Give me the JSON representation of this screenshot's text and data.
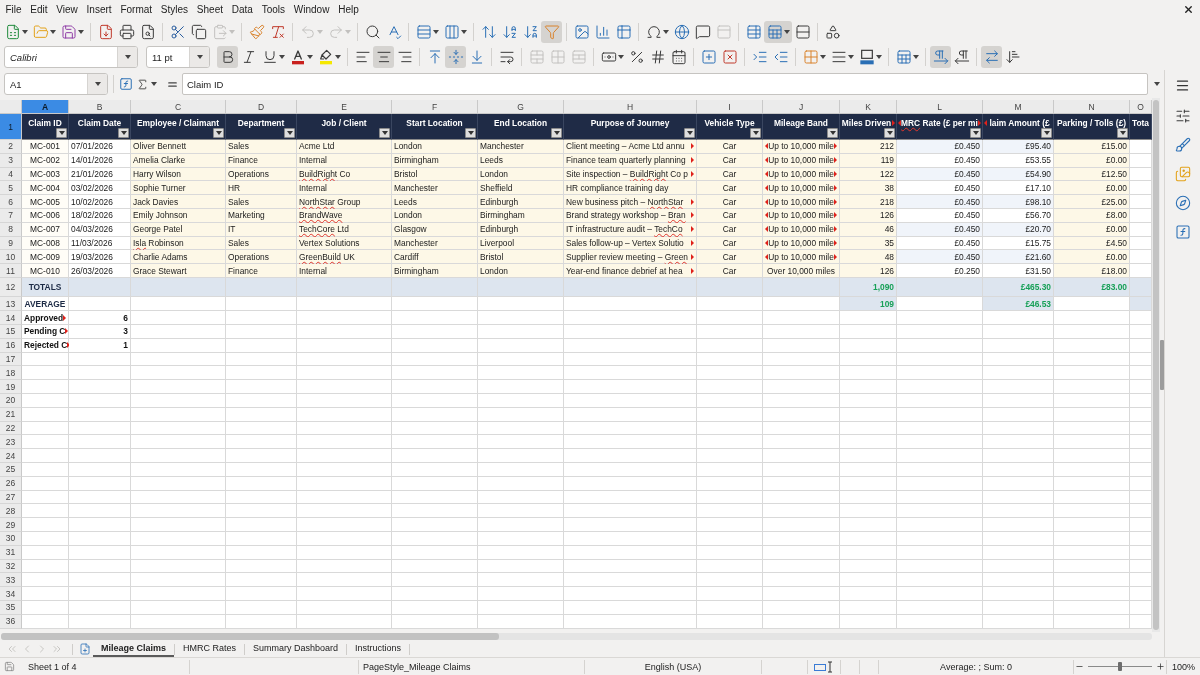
{
  "menu_bar": {
    "items": [
      "File",
      "Edit",
      "View",
      "Insert",
      "Format",
      "Styles",
      "Sheet",
      "Data",
      "Tools",
      "Window",
      "Help"
    ]
  },
  "standard_toolbar": {
    "groups": [
      [
        {
          "kind": "new",
          "menu": true,
          "pressed": false,
          "disabled": false
        },
        {
          "kind": "open",
          "menu": true,
          "pressed": false,
          "disabled": false
        },
        {
          "kind": "save",
          "menu": true,
          "pressed": false,
          "disabled": false
        }
      ],
      [
        {
          "kind": "pdf",
          "menu": false,
          "pressed": false,
          "disabled": false
        },
        {
          "kind": "print",
          "menu": false,
          "pressed": false,
          "disabled": false
        },
        {
          "kind": "preview",
          "menu": false,
          "pressed": false,
          "disabled": false
        }
      ],
      [
        {
          "kind": "cut",
          "menu": false,
          "pressed": false,
          "disabled": false
        },
        {
          "kind": "copy",
          "menu": false,
          "pressed": false,
          "disabled": false
        },
        {
          "kind": "paste",
          "menu": true,
          "pressed": false,
          "disabled": true
        }
      ],
      [
        {
          "kind": "brush",
          "menu": false,
          "pressed": false,
          "disabled": false
        },
        {
          "kind": "clear",
          "menu": false,
          "pressed": false,
          "disabled": false
        }
      ],
      [
        {
          "kind": "undo",
          "menu": true,
          "pressed": false,
          "disabled": true
        },
        {
          "kind": "redo",
          "menu": true,
          "pressed": false,
          "disabled": true
        }
      ],
      [
        {
          "kind": "find",
          "menu": false,
          "pressed": false,
          "disabled": false
        },
        {
          "kind": "spelling",
          "menu": false,
          "pressed": false,
          "disabled": false
        }
      ],
      [
        {
          "kind": "rows",
          "menu": true,
          "pressed": false,
          "disabled": false
        },
        {
          "kind": "columns",
          "menu": true,
          "pressed": false,
          "disabled": false
        }
      ],
      [
        {
          "kind": "sort",
          "menu": false,
          "pressed": false,
          "disabled": false
        },
        {
          "kind": "ascending",
          "menu": false,
          "pressed": false,
          "disabled": false
        },
        {
          "kind": "descending",
          "menu": false,
          "pressed": false,
          "disabled": false
        },
        {
          "kind": "filter",
          "menu": false,
          "pressed": true,
          "disabled": false
        }
      ],
      [
        {
          "kind": "image",
          "menu": false,
          "pressed": false,
          "disabled": false
        },
        {
          "kind": "chart",
          "menu": false,
          "pressed": false,
          "disabled": false
        },
        {
          "kind": "pivot",
          "menu": false,
          "pressed": false,
          "disabled": false
        }
      ],
      [
        {
          "kind": "symbol",
          "menu": true,
          "pressed": false,
          "disabled": false
        },
        {
          "kind": "link",
          "menu": false,
          "pressed": false,
          "disabled": false
        },
        {
          "kind": "comment",
          "menu": false,
          "pressed": false,
          "disabled": false
        },
        {
          "kind": "headers",
          "menu": false,
          "pressed": false,
          "disabled": true
        }
      ],
      [
        {
          "kind": "printarea",
          "menu": false,
          "pressed": false,
          "disabled": false
        },
        {
          "kind": "freeze",
          "menu": true,
          "pressed": true,
          "disabled": false
        },
        {
          "kind": "split",
          "menu": false,
          "pressed": false,
          "disabled": false
        }
      ],
      [
        {
          "kind": "shapes",
          "menu": false,
          "pressed": false,
          "disabled": false
        }
      ]
    ]
  },
  "formatting_toolbar": {
    "font_name": {
      "value": "Calibri"
    },
    "font_size": {
      "value": "11 pt"
    },
    "groups": [
      [
        {
          "kind": "bold",
          "menu": false,
          "pressed": true,
          "disabled": false
        },
        {
          "kind": "italic",
          "menu": false,
          "pressed": false,
          "disabled": false
        },
        {
          "kind": "underline",
          "menu": true,
          "pressed": false,
          "disabled": false
        },
        {
          "kind": "fontcolor",
          "menu": true,
          "pressed": false,
          "disabled": false
        },
        {
          "kind": "highlight",
          "menu": true,
          "pressed": false,
          "disabled": false
        }
      ],
      [
        {
          "kind": "left",
          "menu": false,
          "pressed": false,
          "disabled": false
        },
        {
          "kind": "center",
          "menu": false,
          "pressed": true,
          "disabled": false
        },
        {
          "kind": "right",
          "menu": false,
          "pressed": false,
          "disabled": false
        }
      ],
      [
        {
          "kind": "top",
          "menu": false,
          "pressed": false,
          "disabled": false
        },
        {
          "kind": "middle",
          "menu": false,
          "pressed": true,
          "disabled": false
        },
        {
          "kind": "bottom",
          "menu": false,
          "pressed": false,
          "disabled": false
        }
      ],
      [
        {
          "kind": "wrap",
          "menu": false,
          "pressed": false,
          "disabled": false
        }
      ],
      [
        {
          "kind": "mergecenter",
          "menu": false,
          "pressed": false,
          "disabled": true
        },
        {
          "kind": "merge",
          "menu": false,
          "pressed": false,
          "disabled": true
        },
        {
          "kind": "unmerge",
          "menu": false,
          "pressed": false,
          "disabled": true
        }
      ],
      [
        {
          "kind": "currency",
          "menu": true,
          "pressed": false,
          "disabled": false
        },
        {
          "kind": "percent",
          "menu": false,
          "pressed": false,
          "disabled": false
        },
        {
          "kind": "number",
          "menu": false,
          "pressed": false,
          "disabled": false
        },
        {
          "kind": "date",
          "menu": false,
          "pressed": false,
          "disabled": false
        }
      ],
      [
        {
          "kind": "adddecimal",
          "menu": false,
          "pressed": false,
          "disabled": false
        },
        {
          "kind": "deldecimal",
          "menu": false,
          "pressed": false,
          "disabled": false
        }
      ],
      [
        {
          "kind": "indent",
          "menu": false,
          "pressed": false,
          "disabled": false
        },
        {
          "kind": "outdent",
          "menu": false,
          "pressed": false,
          "disabled": false
        }
      ],
      [
        {
          "kind": "borders",
          "menu": true,
          "pressed": false,
          "disabled": false
        },
        {
          "kind": "borderstyle",
          "menu": true,
          "pressed": false,
          "disabled": false
        },
        {
          "kind": "bordercolor",
          "menu": true,
          "pressed": false,
          "disabled": false
        }
      ],
      [
        {
          "kind": "conditional",
          "menu": true,
          "pressed": false,
          "disabled": false
        }
      ],
      [
        {
          "kind": "ltr",
          "menu": false,
          "pressed": true,
          "disabled": false
        },
        {
          "kind": "rtl",
          "menu": false,
          "pressed": false,
          "disabled": false
        }
      ],
      [
        {
          "kind": "autowrap",
          "menu": false,
          "pressed": true,
          "disabled": false
        },
        {
          "kind": "stacked",
          "menu": false,
          "pressed": false,
          "disabled": false
        }
      ]
    ]
  },
  "formula_bar": {
    "cell_reference": "A1",
    "content": "Claim ID"
  },
  "sidebar": {
    "decks": [
      {
        "kind": "properties"
      },
      {
        "kind": "styles"
      },
      {
        "kind": "gallery"
      },
      {
        "kind": "navigator"
      },
      {
        "kind": "functions"
      }
    ]
  },
  "sheet": {
    "columns": [
      {
        "letter": "A",
        "selected": true
      },
      {
        "letter": "B",
        "selected": false
      },
      {
        "letter": "C",
        "selected": false
      },
      {
        "letter": "D",
        "selected": false
      },
      {
        "letter": "E",
        "selected": false
      },
      {
        "letter": "F",
        "selected": false
      },
      {
        "letter": "G",
        "selected": false
      },
      {
        "letter": "H",
        "selected": false
      },
      {
        "letter": "I",
        "selected": false
      },
      {
        "letter": "J",
        "selected": false
      },
      {
        "letter": "K",
        "selected": false
      },
      {
        "letter": "L",
        "selected": false
      },
      {
        "letter": "M",
        "selected": false
      },
      {
        "letter": "N",
        "selected": false
      },
      {
        "letter": "O",
        "selected": false
      }
    ],
    "header_row": {
      "number": "1",
      "selected": true,
      "cells": [
        {
          "text": "Claim ID",
          "filter": true,
          "clip_left": false,
          "clip_right": false
        },
        {
          "text": "Claim Date",
          "filter": true,
          "clip_left": false,
          "clip_right": false
        },
        {
          "text": "Employee / Claimant",
          "filter": true,
          "clip_left": false,
          "clip_right": false
        },
        {
          "text": "Department",
          "filter": true,
          "clip_left": false,
          "clip_right": false
        },
        {
          "text": "Job / Client",
          "filter": true,
          "clip_left": false,
          "clip_right": false
        },
        {
          "text": "Start Location",
          "filter": true,
          "clip_left": false,
          "clip_right": false
        },
        {
          "text": "End Location",
          "filter": true,
          "clip_left": false,
          "clip_right": false
        },
        {
          "text": "Purpose of Journey",
          "filter": true,
          "clip_left": false,
          "clip_right": false
        },
        {
          "text": "Vehicle Type",
          "filter": true,
          "clip_left": false,
          "clip_right": false
        },
        {
          "text": "Mileage Band",
          "filter": true,
          "clip_left": false,
          "clip_right": false
        },
        {
          "text": "Miles Driven",
          "filter": true,
          "clip_left": false,
          "clip_right": true
        },
        {
          "spans": [
            {
              "text": "MRC",
              "misspelled": true
            },
            {
              "text": " Rate (£ per mi",
              "misspelled": false
            }
          ],
          "filter": true,
          "clip_left": true,
          "clip_right": true
        },
        {
          "text": "laim Amount (£",
          "filter": true,
          "clip_left": true,
          "clip_right": false
        },
        {
          "text": "Parking / Tolls (£)",
          "filter": true,
          "clip_left": false,
          "clip_right": false
        },
        {
          "text": "Tota",
          "filter": false,
          "clip_left": false,
          "clip_right": false
        }
      ]
    },
    "rows": [
      {
        "number": "2",
        "selected": false,
        "kind": "data",
        "cells": [
          "MC-001",
          "07/01/2026",
          "Oliver Bennett",
          "Sales",
          "Acme Ltd",
          "London",
          "Manchester",
          {
            "text": "Client meeting – Acme Ltd annu",
            "clip_left": false,
            "clip_right": true
          },
          "Car",
          {
            "text": "Up to 10,000 mile",
            "clip_left": true,
            "clip_right": true
          },
          "212",
          "£0.450",
          "£95.40",
          "£15.00"
        ]
      },
      {
        "number": "3",
        "selected": false,
        "kind": "data",
        "cells": [
          "MC-002",
          "14/01/2026",
          "Amelia Clarke",
          "Finance",
          "Internal",
          "Birmingham",
          "Leeds",
          {
            "text": "Finance team quarterly planning",
            "clip_left": false,
            "clip_right": true
          },
          "Car",
          {
            "text": "Up to 10,000 mile",
            "clip_left": true,
            "clip_right": true
          },
          "119",
          "£0.450",
          "£53.55",
          "£0.00"
        ]
      },
      {
        "number": "4",
        "selected": false,
        "kind": "data",
        "cells": [
          "MC-003",
          "21/01/2026",
          "Harry Wilson",
          "Operations",
          {
            "spans": [
              {
                "text": "BuildRight",
                "misspelled": true
              },
              {
                "text": " Co",
                "misspelled": false
              }
            ],
            "clip_left": false,
            "clip_right": false
          },
          "Bristol",
          "London",
          {
            "spans": [
              {
                "text": "Site inspection – ",
                "misspelled": false
              },
              {
                "text": "BuildRight",
                "misspelled": true
              },
              {
                "text": " Co p",
                "misspelled": false
              }
            ],
            "clip_left": false,
            "clip_right": true
          },
          "Car",
          {
            "text": "Up to 10,000 mile",
            "clip_left": true,
            "clip_right": true
          },
          "122",
          "£0.450",
          "£54.90",
          "£12.50"
        ]
      },
      {
        "number": "5",
        "selected": false,
        "kind": "data",
        "cells": [
          "MC-004",
          "03/02/2026",
          "Sophie Turner",
          "HR",
          "Internal",
          "Manchester",
          "Sheffield",
          "HR compliance training day",
          "Car",
          {
            "text": "Up to 10,000 mile",
            "clip_left": true,
            "clip_right": true
          },
          "38",
          "£0.450",
          "£17.10",
          "£0.00"
        ]
      },
      {
        "number": "6",
        "selected": false,
        "kind": "data",
        "cells": [
          "MC-005",
          "10/02/2026",
          "Jack Davies",
          "Sales",
          {
            "spans": [
              {
                "text": "NorthStar",
                "misspelled": true
              },
              {
                "text": " Group",
                "misspelled": false
              }
            ],
            "clip_left": false,
            "clip_right": false
          },
          "Leeds",
          "Edinburgh",
          {
            "spans": [
              {
                "text": "New business pitch – ",
                "misspelled": false
              },
              {
                "text": "NorthStar",
                "misspelled": true
              }
            ],
            "clip_left": false,
            "clip_right": true
          },
          "Car",
          {
            "text": "Up to 10,000 mile",
            "clip_left": true,
            "clip_right": true
          },
          "218",
          "£0.450",
          "£98.10",
          "£25.00"
        ]
      },
      {
        "number": "7",
        "selected": false,
        "kind": "data",
        "cells": [
          "MC-006",
          "18/02/2026",
          "Emily Johnson",
          "Marketing",
          {
            "spans": [
              {
                "text": "BrandWave",
                "misspelled": true
              }
            ],
            "clip_left": false,
            "clip_right": false
          },
          "London",
          "Birmingham",
          {
            "spans": [
              {
                "text": "Brand strategy workshop – ",
                "misspelled": false
              },
              {
                "text": "Bran",
                "misspelled": true
              }
            ],
            "clip_left": false,
            "clip_right": true
          },
          "Car",
          {
            "text": "Up to 10,000 mile",
            "clip_left": true,
            "clip_right": true
          },
          "126",
          "£0.450",
          "£56.70",
          "£8.00"
        ]
      },
      {
        "number": "8",
        "selected": false,
        "kind": "data",
        "cells": [
          "MC-007",
          "04/03/2026",
          "George Patel",
          "IT",
          {
            "spans": [
              {
                "text": "TechCore",
                "misspelled": true
              },
              {
                "text": " Ltd",
                "misspelled": false
              }
            ],
            "clip_left": false,
            "clip_right": false
          },
          "Glasgow",
          "Edinburgh",
          {
            "spans": [
              {
                "text": "IT infrastructure audit – ",
                "misspelled": false
              },
              {
                "text": "TechCo",
                "misspelled": true
              }
            ],
            "clip_left": false,
            "clip_right": true
          },
          "Car",
          {
            "text": "Up to 10,000 mile",
            "clip_left": true,
            "clip_right": true
          },
          "46",
          "£0.450",
          "£20.70",
          "£0.00"
        ]
      },
      {
        "number": "9",
        "selected": false,
        "kind": "data",
        "cells": [
          "MC-008",
          "11/03/2026",
          {
            "spans": [
              {
                "text": "Isla",
                "misspelled": true
              },
              {
                "text": " Robinson",
                "misspelled": false
              }
            ],
            "clip_left": false,
            "clip_right": false
          },
          "Sales",
          "Vertex Solutions",
          "Manchester",
          "Liverpool",
          {
            "text": "Sales follow-up – Vertex Solutio",
            "clip_left": false,
            "clip_right": true
          },
          "Car",
          {
            "text": "Up to 10,000 mile",
            "clip_left": true,
            "clip_right": true
          },
          "35",
          "£0.450",
          "£15.75",
          "£4.50"
        ]
      },
      {
        "number": "10",
        "selected": false,
        "kind": "data",
        "cells": [
          "MC-009",
          "19/03/2026",
          "Charlie Adams",
          "Operations",
          {
            "spans": [
              {
                "text": "GreenBuild",
                "misspelled": true
              },
              {
                "text": " UK",
                "misspelled": false
              }
            ],
            "clip_left": false,
            "clip_right": false
          },
          "Cardiff",
          "Bristol",
          {
            "spans": [
              {
                "text": "Supplier review meeting – ",
                "misspelled": false
              },
              {
                "text": "Green",
                "misspelled": true
              }
            ],
            "clip_left": false,
            "clip_right": true
          },
          "Car",
          {
            "text": "Up to 10,000 mile",
            "clip_left": true,
            "clip_right": true
          },
          "48",
          "£0.450",
          "£21.60",
          "£0.00"
        ]
      },
      {
        "number": "11",
        "selected": false,
        "kind": "data",
        "cells": [
          "MC-010",
          "26/03/2026",
          "Grace Stewart",
          "Finance",
          "Internal",
          "Birmingham",
          "London",
          {
            "text": "Year-end finance debrief at hea",
            "clip_left": false,
            "clip_right": true
          },
          "Car",
          "Over 10,000 miles",
          "126",
          "£0.250",
          "£31.50",
          "£18.00"
        ]
      },
      {
        "number": "12",
        "selected": false,
        "kind": "total",
        "cells": [
          "TOTALS",
          null,
          null,
          null,
          null,
          null,
          null,
          null,
          null,
          null,
          "1,090",
          null,
          "£465.30",
          "£83.00"
        ]
      },
      {
        "number": "13",
        "selected": false,
        "kind": "average",
        "cells": [
          "AVERAGE",
          null,
          null,
          null,
          null,
          null,
          null,
          null,
          null,
          null,
          "109",
          null,
          "£46.53"
        ]
      },
      {
        "number": "14",
        "selected": false,
        "kind": "count",
        "cells": [
          {
            "text": "Approved",
            "clip_left": false,
            "clip_right": true
          },
          "6"
        ]
      },
      {
        "number": "15",
        "selected": false,
        "kind": "count",
        "cells": [
          {
            "text": "Pending C",
            "clip_left": false,
            "clip_right": true
          },
          "3"
        ]
      },
      {
        "number": "16",
        "selected": false,
        "kind": "count",
        "cells": [
          {
            "text": "Rejected C",
            "clip_left": false,
            "clip_right": true
          },
          "1"
        ]
      },
      {
        "number": "17",
        "selected": false,
        "kind": "blank"
      },
      {
        "number": "18",
        "selected": false,
        "kind": "blank"
      },
      {
        "number": "19",
        "selected": false,
        "kind": "blank"
      },
      {
        "number": "20",
        "selected": false,
        "kind": "blank"
      },
      {
        "number": "21",
        "selected": false,
        "kind": "blank"
      },
      {
        "number": "22",
        "selected": false,
        "kind": "blank"
      },
      {
        "number": "23",
        "selected": false,
        "kind": "blank"
      },
      {
        "number": "24",
        "selected": false,
        "kind": "blank"
      },
      {
        "number": "25",
        "selected": false,
        "kind": "blank"
      },
      {
        "number": "26",
        "selected": false,
        "kind": "blank"
      },
      {
        "number": "27",
        "selected": false,
        "kind": "blank"
      },
      {
        "number": "28",
        "selected": false,
        "kind": "blank"
      },
      {
        "number": "29",
        "selected": false,
        "kind": "blank"
      },
      {
        "number": "30",
        "selected": false,
        "kind": "blank"
      },
      {
        "number": "31",
        "selected": false,
        "kind": "blank"
      },
      {
        "number": "32",
        "selected": false,
        "kind": "blank"
      },
      {
        "number": "33",
        "selected": false,
        "kind": "blank"
      },
      {
        "number": "34",
        "selected": false,
        "kind": "blank"
      },
      {
        "number": "35",
        "selected": false,
        "kind": "blank"
      },
      {
        "number": "36",
        "selected": false,
        "kind": "blank"
      }
    ]
  },
  "sheet_tabs": {
    "navigation": [
      {
        "kind": "first",
        "disabled": true
      },
      {
        "kind": "previous",
        "disabled": true
      },
      {
        "kind": "next",
        "disabled": true
      },
      {
        "kind": "last",
        "disabled": true
      }
    ],
    "tabs": [
      {
        "label": "Mileage Claims",
        "selected": true
      },
      {
        "label": "HMRC Rates",
        "selected": false
      },
      {
        "label": "Summary Dashboard",
        "selected": false
      },
      {
        "label": "Instructions",
        "selected": false
      }
    ]
  },
  "status_bar": {
    "sheet_position": "Sheet 1 of 4",
    "page_style": "PageStyle_Mileage Claims",
    "language": "English (USA)",
    "selection_summary": "Average: ; Sum: 0",
    "zoom": {
      "level": 0.5,
      "reading": "100%"
    }
  }
}
